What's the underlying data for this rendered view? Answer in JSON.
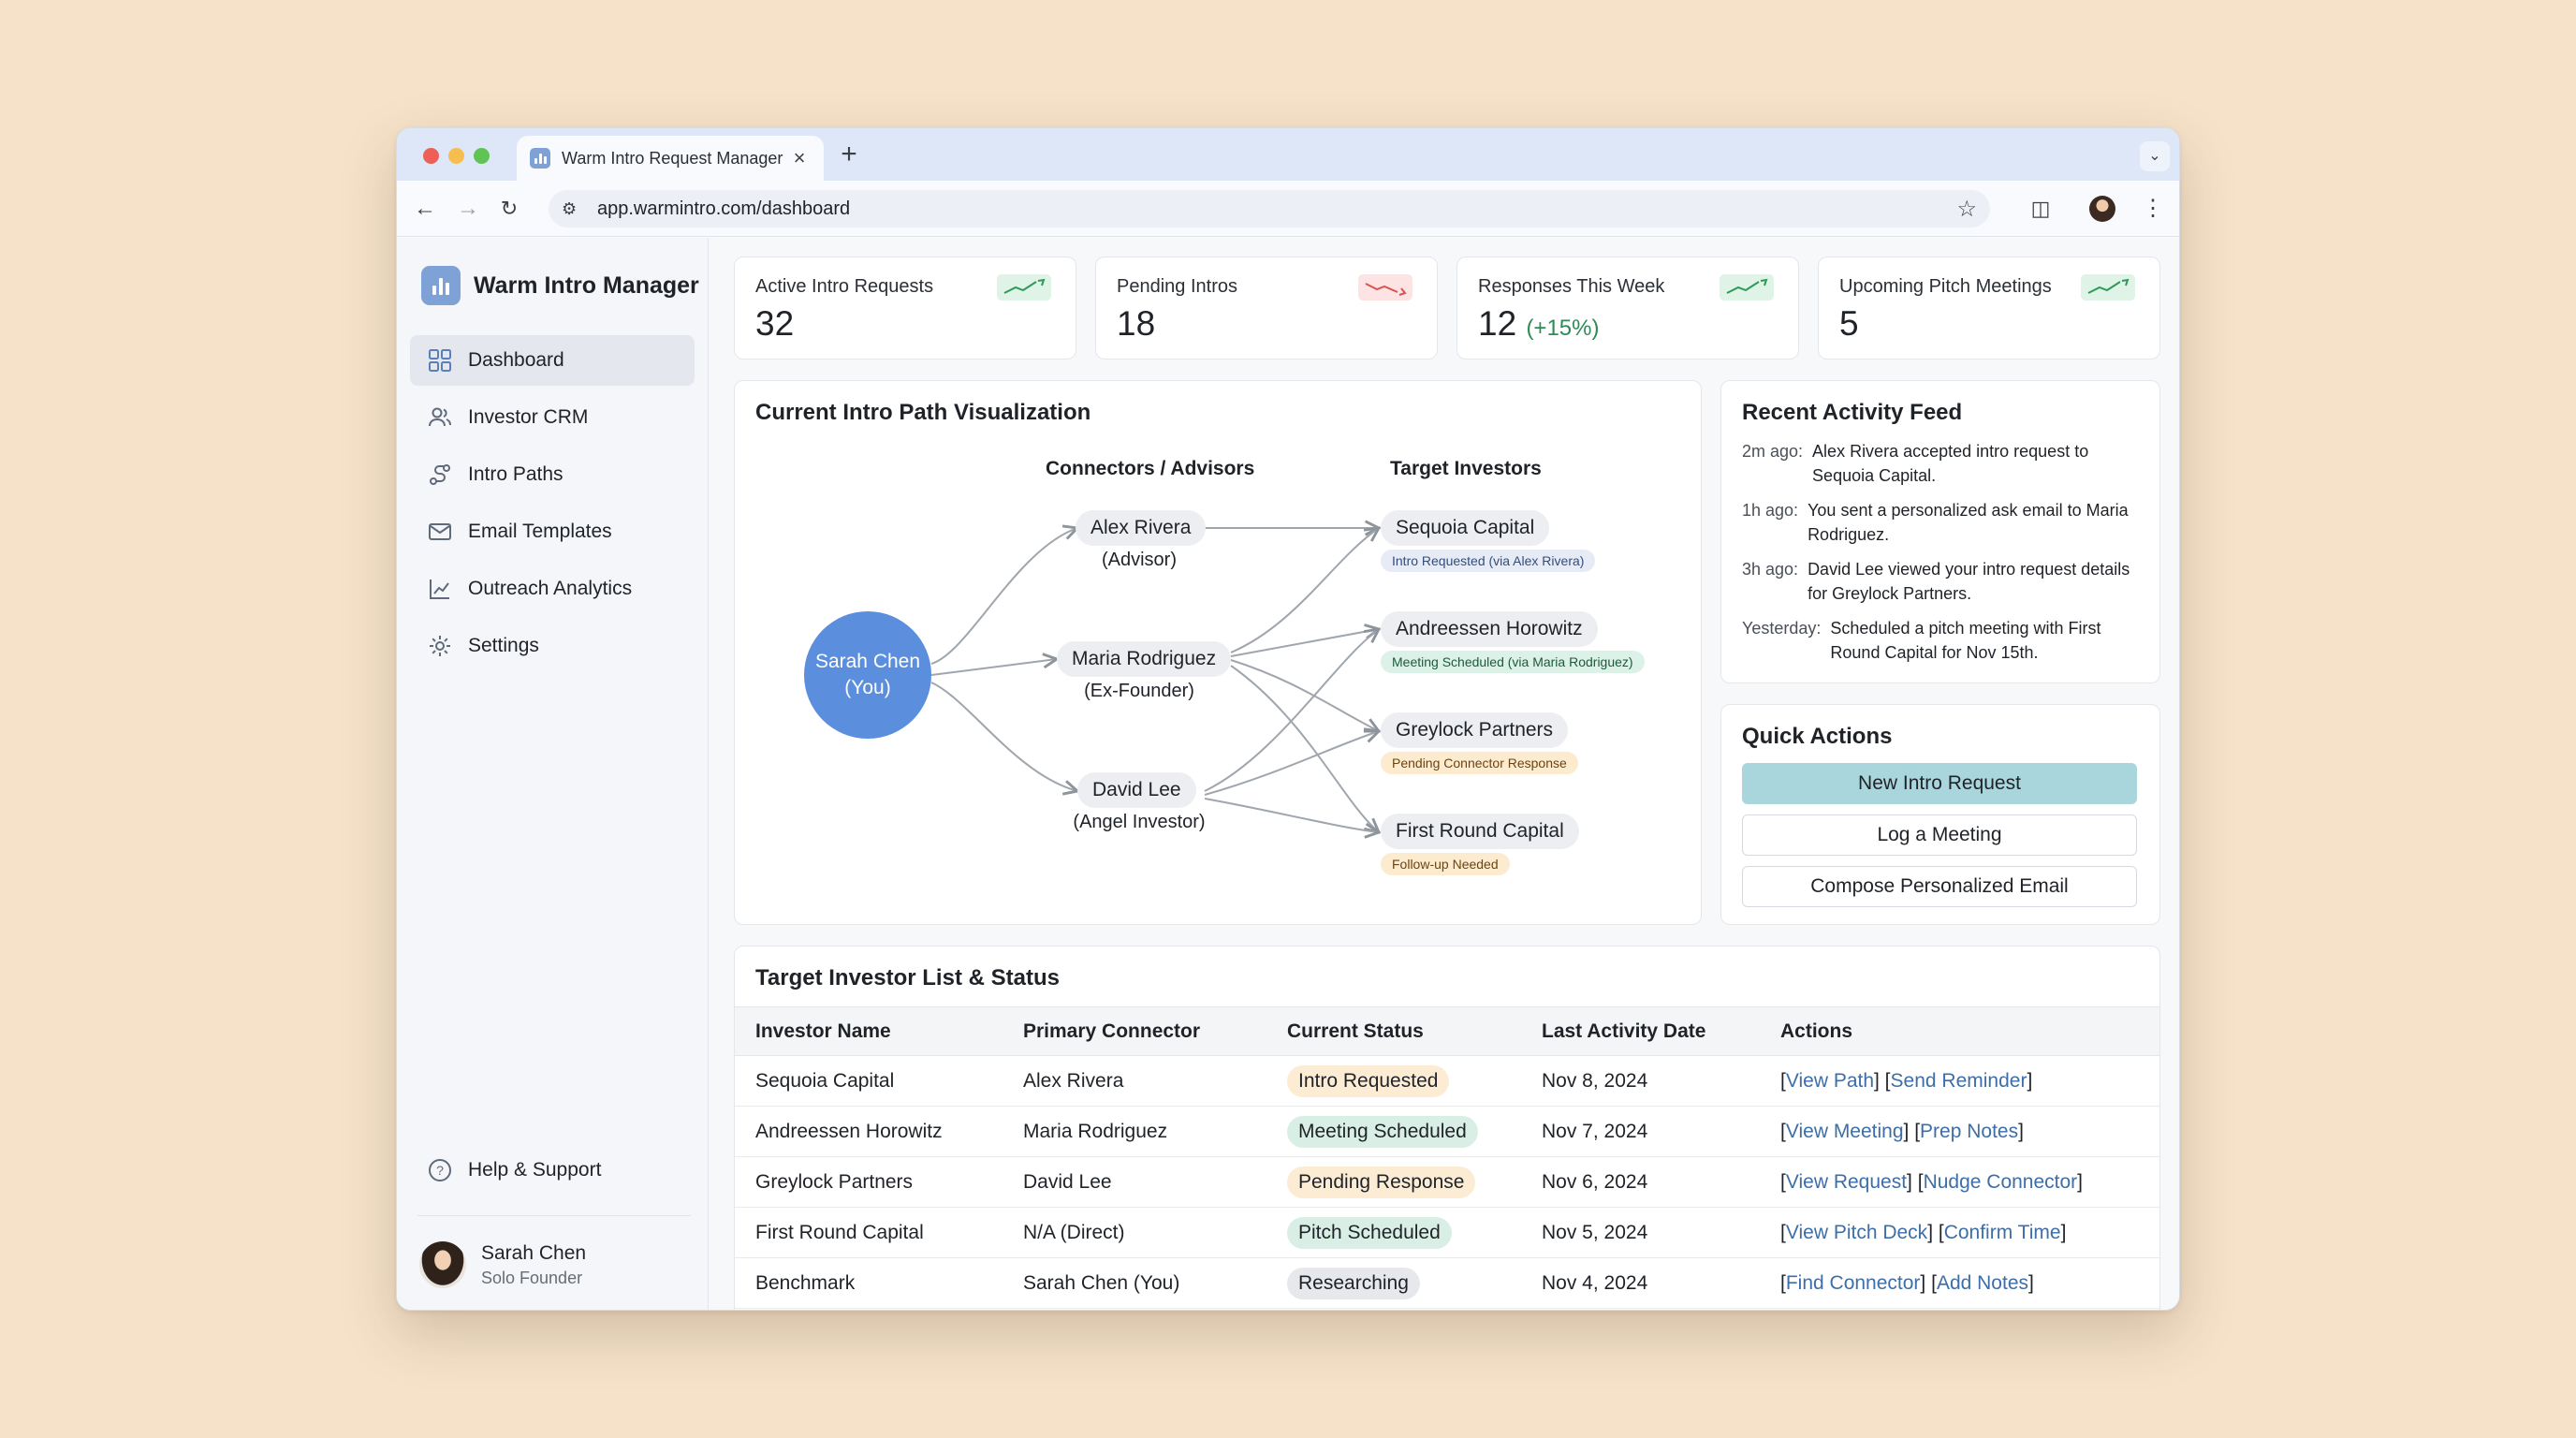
{
  "browser": {
    "tab_title": "Warm Intro Request Manager",
    "tab_close": "×",
    "new_tab": "+",
    "url": "app.warmintro.com/dashboard"
  },
  "sidebar": {
    "brand": "Warm Intro Manager",
    "items": [
      {
        "label": "Dashboard",
        "icon": "grid-icon",
        "active": true
      },
      {
        "label": "Investor CRM",
        "icon": "users-icon"
      },
      {
        "label": "Intro Paths",
        "icon": "route-icon"
      },
      {
        "label": "Email Templates",
        "icon": "mail-icon"
      },
      {
        "label": "Outreach Analytics",
        "icon": "chart-line-icon"
      },
      {
        "label": "Settings",
        "icon": "gear-icon"
      }
    ],
    "help": "Help & Support",
    "user": {
      "name": "Sarah Chen",
      "role": "Solo Founder"
    }
  },
  "kpis": [
    {
      "label": "Active Intro Requests",
      "value": "32",
      "delta": "",
      "trend": "up"
    },
    {
      "label": "Pending Intros",
      "value": "18",
      "delta": "",
      "trend": "down"
    },
    {
      "label": "Responses This Week",
      "value": "12",
      "delta": "(+15%)",
      "trend": "up"
    },
    {
      "label": "Upcoming Pitch Meetings",
      "value": "5",
      "delta": "",
      "trend": "up"
    }
  ],
  "path_viz": {
    "title": "Current Intro Path Visualization",
    "col_connectors": "Connectors / Advisors",
    "col_targets": "Target Investors",
    "me": {
      "line1": "Sarah Chen",
      "line2": "(You)"
    },
    "connectors": [
      {
        "name": "Alex Rivera",
        "role": "(Advisor)"
      },
      {
        "name": "Maria Rodriguez",
        "role": "(Ex-Founder)"
      },
      {
        "name": "David Lee",
        "role": "(Angel Investor)"
      }
    ],
    "targets": [
      {
        "name": "Sequoia Capital",
        "status": "Intro Requested (via Alex Rivera)"
      },
      {
        "name": "Andreessen Horowitz",
        "status": "Meeting Scheduled (via Maria Rodriguez)"
      },
      {
        "name": "Greylock Partners",
        "status": "Pending Connector Response"
      },
      {
        "name": "First Round Capital",
        "status": "Follow-up Needed"
      }
    ]
  },
  "activity": {
    "title": "Recent Activity Feed",
    "items": [
      {
        "time": "2m ago:",
        "text": "Alex Rivera accepted intro request to Sequoia Capital."
      },
      {
        "time": "1h ago:",
        "text": "You sent a personalized ask email to Maria Rodriguez."
      },
      {
        "time": "3h ago:",
        "text": "David Lee viewed your intro request details for Greylock Partners."
      },
      {
        "time": "Yesterday:",
        "text": "Scheduled a pitch meeting with First Round Capital for Nov 15th."
      }
    ]
  },
  "quick_actions": {
    "title": "Quick Actions",
    "buttons": [
      "New Intro Request",
      "Log a Meeting",
      "Compose Personalized Email"
    ]
  },
  "investor_table": {
    "title": "Target Investor List & Status",
    "headers": [
      "Investor Name",
      "Primary Connector",
      "Current Status",
      "Last Activity Date",
      "Actions"
    ],
    "rows": [
      {
        "investor": "Sequoia Capital",
        "connector": "Alex Rivera",
        "status": "Intro Requested",
        "status_color": "amber",
        "date": "Nov 8, 2024",
        "actions": [
          "View Path",
          "Send Reminder"
        ]
      },
      {
        "investor": "Andreessen Horowitz",
        "connector": "Maria Rodriguez",
        "status": "Meeting Scheduled",
        "status_color": "green",
        "date": "Nov 7, 2024",
        "actions": [
          "View Meeting",
          "Prep Notes"
        ]
      },
      {
        "investor": "Greylock Partners",
        "connector": "David Lee",
        "status": "Pending Response",
        "status_color": "amber",
        "date": "Nov 6, 2024",
        "actions": [
          "View Request",
          "Nudge Connector"
        ]
      },
      {
        "investor": "First Round Capital",
        "connector": "N/A (Direct)",
        "status": "Pitch Scheduled",
        "status_color": "green",
        "date": "Nov 5, 2024",
        "actions": [
          "View Pitch Deck",
          "Confirm Time"
        ]
      },
      {
        "investor": "Benchmark",
        "connector": "Sarah Chen (You)",
        "status": "Researching",
        "status_color": "gray",
        "date": "Nov 4, 2024",
        "actions": [
          "Find Connector",
          "Add Notes"
        ]
      }
    ]
  },
  "colors": {
    "accent": "#5b8fdd",
    "primary_button": "#a9d5dc",
    "link": "#3d6ea8"
  }
}
